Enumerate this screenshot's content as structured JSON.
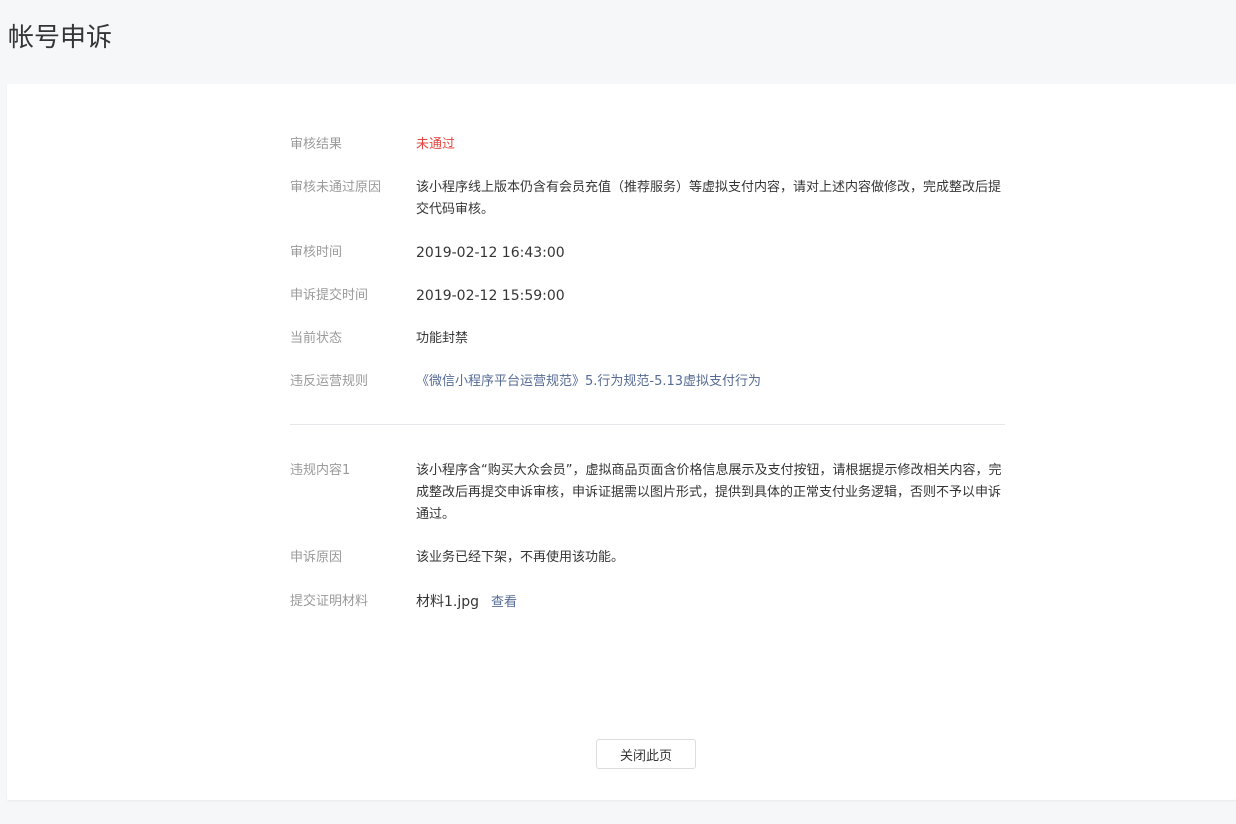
{
  "header": {
    "title": "帐号申诉"
  },
  "review": {
    "result_label": "审核结果",
    "result_value": "未通过",
    "reason_label": "审核未通过原因",
    "reason_value": "该小程序线上版本仍含有会员充值（推荐服务）等虚拟支付内容，请对上述内容做修改，完成整改后提交代码审核。",
    "time_label": "审核时间",
    "time_value": "2019-02-12 16:43:00",
    "appeal_time_label": "申诉提交时间",
    "appeal_time_value": "2019-02-12 15:59:00",
    "status_label": "当前状态",
    "status_value": "功能封禁",
    "rule_label": "违反运营规则",
    "rule_value": "《微信小程序平台运营规范》5.行为规范-5.13虚拟支付行为"
  },
  "violation": {
    "content_label": "违规内容1",
    "content_value": "该小程序含“购买大众会员”，虚拟商品页面含价格信息展示及支付按钮，请根据提示修改相关内容，完成整改后再提交申诉审核，申诉证据需以图片形式，提供到具体的正常支付业务逻辑，否则不予以申诉通过。",
    "appeal_reason_label": "申诉原因",
    "appeal_reason_value": "该业务已经下架，不再使用该功能。",
    "evidence_label": "提交证明材料",
    "evidence_file": "材料1.jpg",
    "evidence_view": "查看"
  },
  "footer": {
    "close_label": "关闭此页"
  },
  "colors": {
    "fail": "#e64340",
    "link": "#576b95",
    "label": "#9a9a9a"
  }
}
